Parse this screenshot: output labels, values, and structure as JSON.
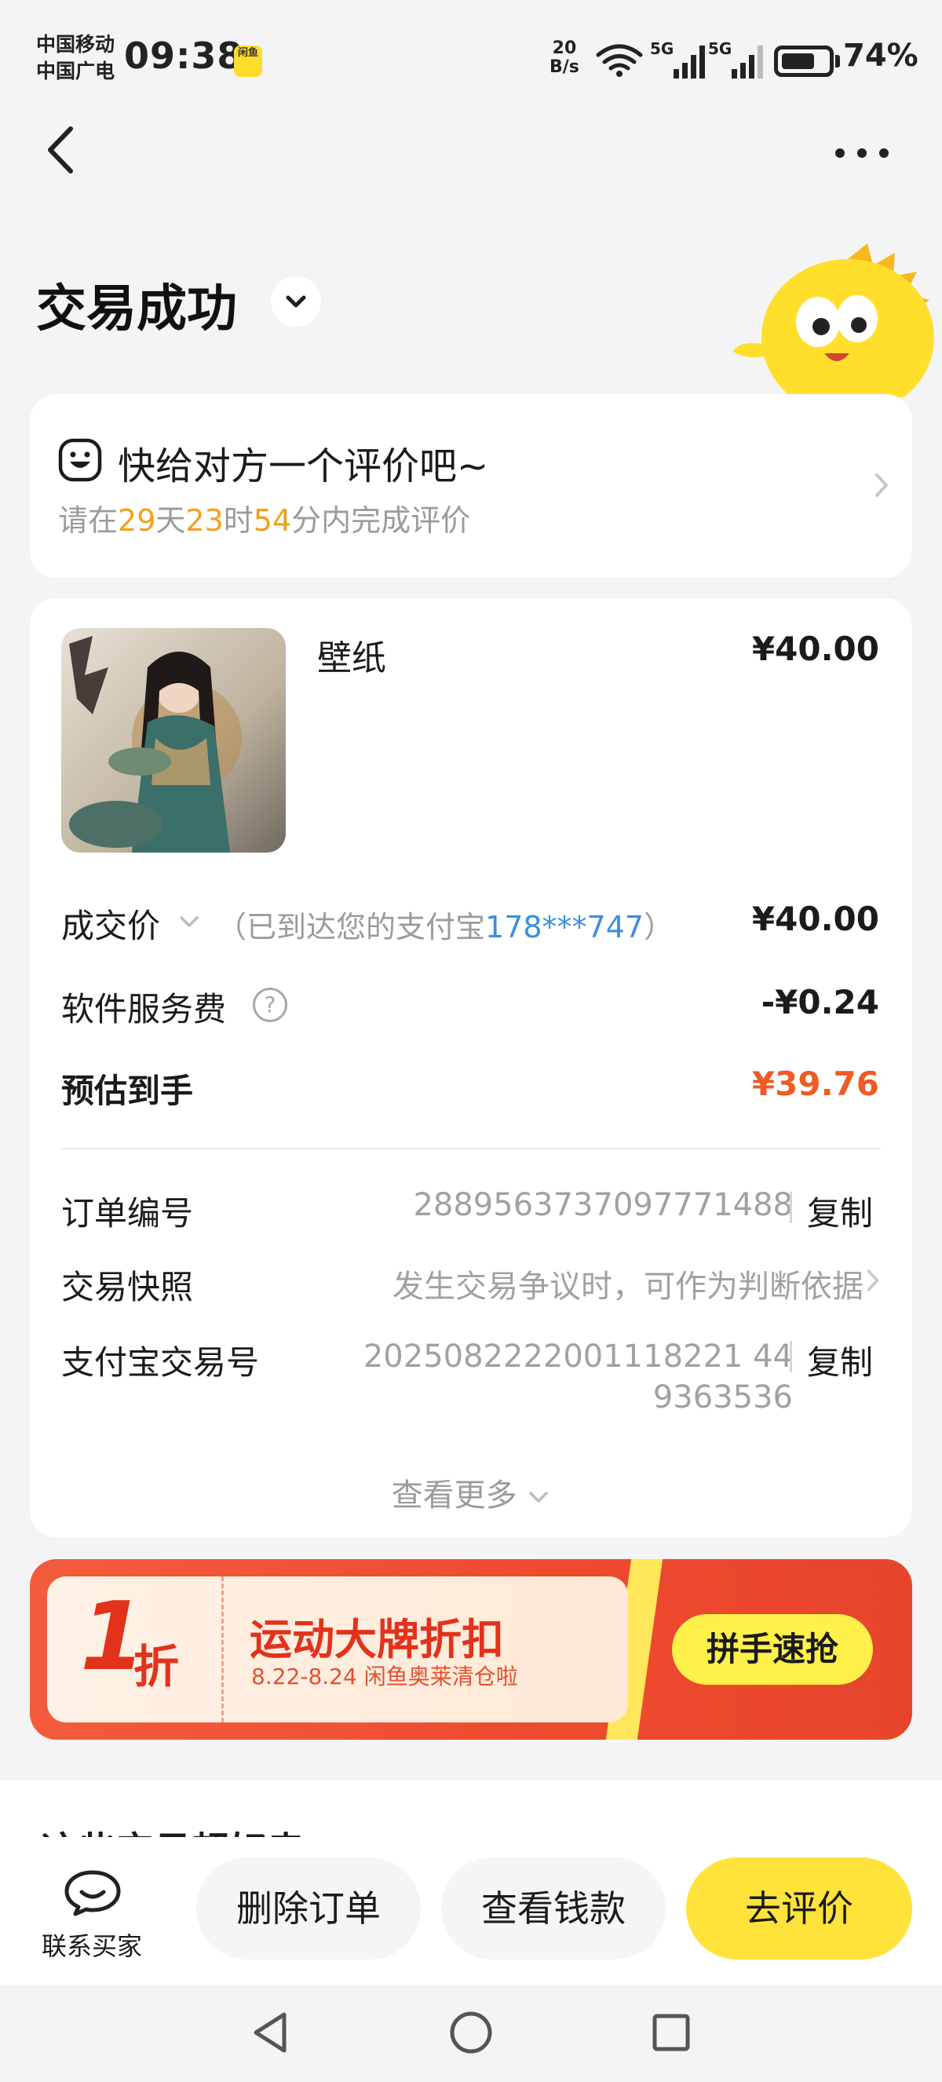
{
  "status_bar": {
    "carrier_1": "中国移动",
    "carrier_2": "中国广电",
    "time": "09:38",
    "app_badge": "闲鱼",
    "net_speed_value": "20",
    "net_speed_unit": "B/s",
    "signal_1": "5G",
    "signal_2": "5G",
    "battery_percent": "74%",
    "battery_level": 0.74
  },
  "header": {
    "title": "交易成功"
  },
  "review": {
    "title": "快给对方一个评价吧~",
    "prefix": "请在",
    "days": "29",
    "days_unit": "天",
    "hours": "23",
    "hours_unit": "时",
    "minutes": "54",
    "suffix": "分内完成评价"
  },
  "order": {
    "item_title": "壁纸",
    "item_price": "¥40.00",
    "deal_price_label": "成交价",
    "deal_note_prefix": "（已到达您的支付宝",
    "deal_note_account": "178***747",
    "deal_note_suffix": "）",
    "deal_price_value": "¥40.00",
    "service_fee_label": "软件服务费",
    "service_fee_value": "-¥0.24",
    "estimated_label": "预估到手",
    "estimated_value": "¥39.76",
    "order_no_label": "订单编号",
    "order_no_value": "2889563737097771488",
    "copy_label": "复制",
    "snapshot_label": "交易快照",
    "snapshot_value": "发生交易争议时，可作为判断依据",
    "alipay_no_label": "支付宝交易号",
    "alipay_no_line1": "2025082222001118221 44",
    "alipay_no_line2": "9363536",
    "see_more": "查看更多"
  },
  "banner": {
    "discount_number": "1",
    "discount_unit": "折",
    "title": "运动大牌折扣",
    "subtitle": "8.22-8.24 闲鱼奥莱清仓啦",
    "button": "拼手速抢"
  },
  "recommend": {
    "peek_title": "这些宝贝超好卖"
  },
  "actions": {
    "contact": "联系买家",
    "delete": "删除订单",
    "view_money": "查看钱款",
    "review": "去评价"
  },
  "colors": {
    "accent_yellow": "#ffe33a",
    "price_red": "#f05a24",
    "countdown_orange": "#f2a01e",
    "link_blue": "#3b8fdc",
    "banner_red": "#ef4a2e"
  }
}
